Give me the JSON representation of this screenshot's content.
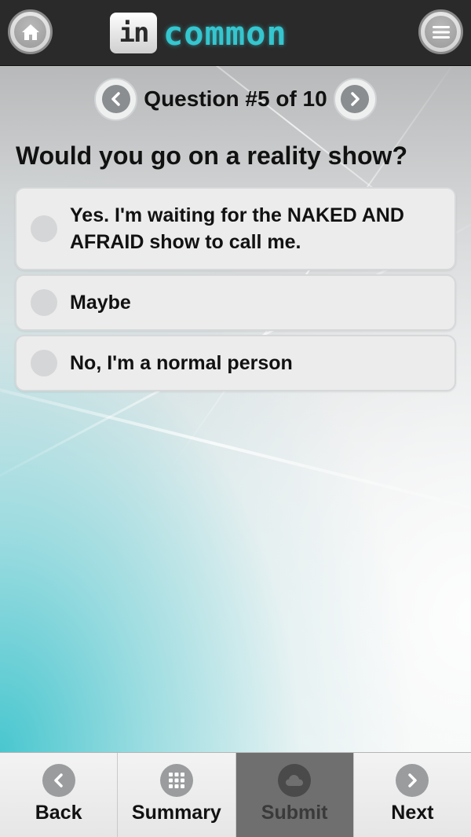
{
  "header": {
    "logo_box_text": "in",
    "logo_text": "common",
    "home_icon": "home-icon",
    "menu_icon": "hamburger-menu-icon"
  },
  "question_nav": {
    "counter": "Question #5 of 10",
    "prev_icon": "chevron-left-icon",
    "next_icon": "chevron-right-icon"
  },
  "question": {
    "text": "Would you go on a reality show?"
  },
  "options": [
    {
      "label": "Yes. I'm waiting for the NAKED AND AFRAID show to call me.",
      "selected": false
    },
    {
      "label": "Maybe",
      "selected": false
    },
    {
      "label": "No, I'm a normal person",
      "selected": false
    }
  ],
  "footer": {
    "tabs": [
      {
        "label": "Back",
        "icon": "chevron-left-icon",
        "active": false
      },
      {
        "label": "Summary",
        "icon": "grid-icon",
        "active": false
      },
      {
        "label": "Submit",
        "icon": "cloud-icon",
        "active": true
      },
      {
        "label": "Next",
        "icon": "chevron-right-icon",
        "active": false
      }
    ]
  },
  "colors": {
    "header_bg": "#2a2a2a",
    "brand_accent": "#35c6cf",
    "active_tab_bg": "#6f6f6f",
    "option_bg": "#ececec"
  }
}
